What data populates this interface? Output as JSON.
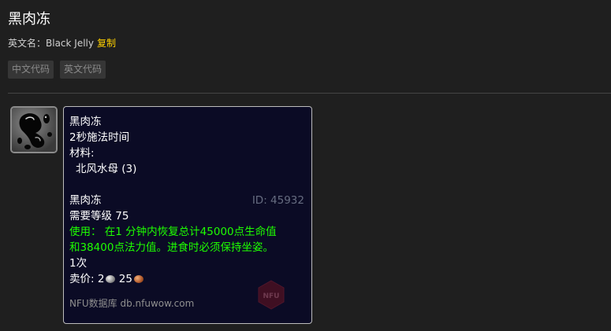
{
  "page": {
    "title": "黑肉冻",
    "english_label": "英文名：",
    "english_name": "Black Jelly",
    "copy_label": "复制"
  },
  "code_buttons": {
    "chinese": "中文代码",
    "english": "英文代码"
  },
  "icon": {
    "name": "black-jelly-icon"
  },
  "tooltip": {
    "recipe_name": "黑肉冻",
    "cast_time": "2秒施法时间",
    "reagents_label": "材料:",
    "reagent": "北风水母 (3)",
    "item_name": "黑肉冻",
    "item_id": "ID: 45932",
    "required_level": "需要等级 75",
    "use_line1": "使用： 在1 分钟内恢复总计45000点生命值",
    "use_line2": "和38400点法力值。进食时必须保持坐姿。",
    "charges": "1次",
    "sell_label": "卖价:",
    "sell_silver": "2",
    "sell_copper": "25",
    "credit": "NFU数据库 db.nfuwow.com",
    "logo_text": "NFU"
  },
  "colors": {
    "use_effect": "#1eff00",
    "copy_link": "#ffd100",
    "tooltip_bg": "#0b0b25"
  }
}
